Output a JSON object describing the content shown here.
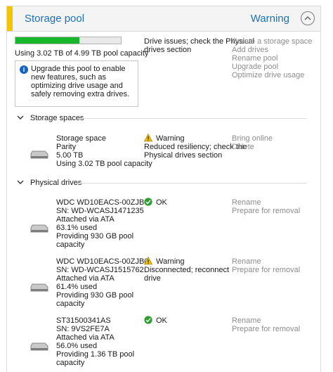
{
  "header": {
    "title": "Storage pool",
    "status": "Warning"
  },
  "pool": {
    "capacity_text": "Using 3.02 TB of 4.99 TB pool capacity",
    "used_fraction": 0.605,
    "issue_text_1": "Drive issues; check the Physical",
    "issue_text_2": "drives section",
    "actions": [
      "Create a storage space",
      "Add drives",
      "Rename pool",
      "Upgrade pool",
      "Optimize drive usage"
    ],
    "info_text": "Upgrade this pool to enable new features, such as optimizing drive usage and safely removing extra drives."
  },
  "sections": {
    "spaces": "Storage spaces",
    "drives": "Physical drives"
  },
  "space": {
    "lines": [
      "Storage space",
      "Parity",
      "5.00 TB",
      "Using 3.02 TB pool capacity"
    ],
    "status": "Warning",
    "status_lines": [
      "Reduced resiliency; check the",
      "Physical drives section"
    ],
    "actions": [
      "Bring online",
      "Delete"
    ]
  },
  "drives": [
    {
      "lines": [
        "WDC WD10EACS-00ZJB0",
        "SN: WD-WCASJ1471235",
        "Attached via ATA",
        "63.1% used",
        "Providing 930 GB pool",
        "capacity"
      ],
      "status": "OK",
      "status_lines": [],
      "actions": [
        "Rename",
        "Prepare for removal"
      ]
    },
    {
      "lines": [
        "WDC WD10EACS-00ZJB0",
        "SN: WD-WCASJ1515762",
        "Attached via ATA",
        "61.4% used",
        "Providing 930 GB pool",
        "capacity"
      ],
      "status": "Warning",
      "status_lines": [
        "Disconnected; reconnect",
        "drive"
      ],
      "actions": [
        "Rename",
        "Prepare for removal"
      ]
    },
    {
      "lines": [
        "ST31500341AS",
        "SN: 9VS2FE7A",
        "Attached via ATA",
        "56.0% used",
        "Providing 1.36 TB pool",
        "capacity"
      ],
      "status": "OK",
      "status_lines": [],
      "actions": [
        "Rename",
        "Prepare for removal"
      ]
    }
  ],
  "colors": {
    "accent": "#f5c400",
    "link": "#1f6fb4",
    "bar": "#18b62a",
    "warning": "#f0c000",
    "ok": "#2e9e2e"
  }
}
